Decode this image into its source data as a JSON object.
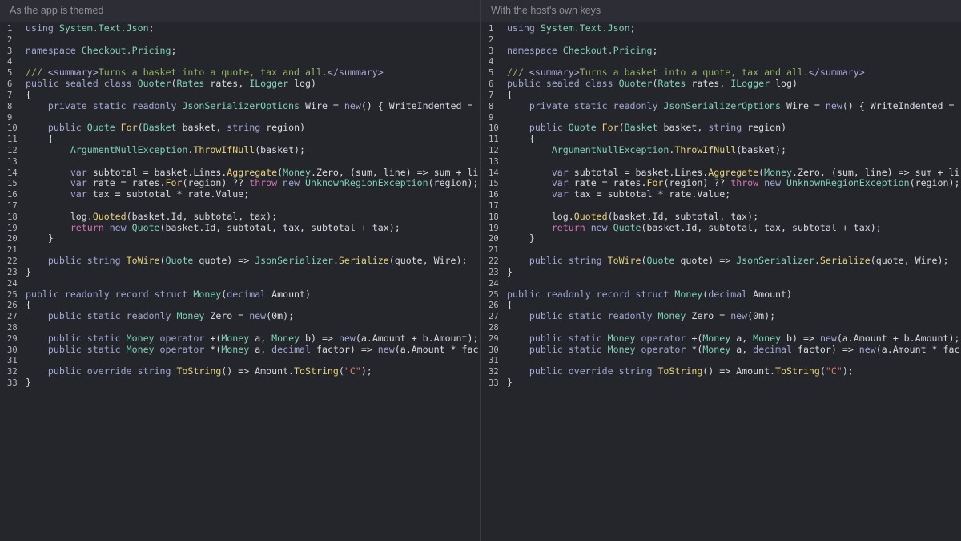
{
  "panes": [
    {
      "title": "As the app is themed"
    },
    {
      "title": "With the host's own keys"
    }
  ],
  "code_lines": [
    {
      "n": "1",
      "tokens": [
        [
          "kw",
          "using "
        ],
        [
          "ty",
          "System.Text.Json"
        ],
        [
          "pl",
          ";"
        ]
      ]
    },
    {
      "n": "2",
      "tokens": []
    },
    {
      "n": "3",
      "tokens": [
        [
          "kw",
          "namespace "
        ],
        [
          "ty",
          "Checkout.Pricing"
        ],
        [
          "pl",
          ";"
        ]
      ]
    },
    {
      "n": "4",
      "tokens": []
    },
    {
      "n": "5",
      "tokens": [
        [
          "cm",
          "/// "
        ],
        [
          "tag",
          "<summary>"
        ],
        [
          "cm",
          "Turns a basket into a quote, tax and all."
        ],
        [
          "tag",
          "</summary>"
        ]
      ]
    },
    {
      "n": "6",
      "tokens": [
        [
          "kw",
          "public sealed class "
        ],
        [
          "ty",
          "Quoter"
        ],
        [
          "pl",
          "("
        ],
        [
          "ty",
          "Rates"
        ],
        [
          "pl",
          " rates, "
        ],
        [
          "ty",
          "ILogger"
        ],
        [
          "pl",
          " log)"
        ]
      ]
    },
    {
      "n": "7",
      "tokens": [
        [
          "pl",
          "{"
        ]
      ]
    },
    {
      "n": "8",
      "tokens": [
        [
          "pl",
          "    "
        ],
        [
          "kw",
          "private static readonly "
        ],
        [
          "ty",
          "JsonSerializerOptions"
        ],
        [
          "pl",
          " Wire = "
        ],
        [
          "kw",
          "new"
        ],
        [
          "pl",
          "() { WriteIndented = "
        ]
      ]
    },
    {
      "n": "9",
      "tokens": []
    },
    {
      "n": "10",
      "tokens": [
        [
          "pl",
          "    "
        ],
        [
          "kw",
          "public "
        ],
        [
          "ty",
          "Quote "
        ],
        [
          "fn",
          "For"
        ],
        [
          "pl",
          "("
        ],
        [
          "ty",
          "Basket"
        ],
        [
          "pl",
          " basket, "
        ],
        [
          "kw",
          "string"
        ],
        [
          "pl",
          " region)"
        ]
      ]
    },
    {
      "n": "11",
      "tokens": [
        [
          "pl",
          "    {"
        ]
      ]
    },
    {
      "n": "12",
      "tokens": [
        [
          "pl",
          "        "
        ],
        [
          "ty",
          "ArgumentNullException"
        ],
        [
          "pl",
          "."
        ],
        [
          "fn",
          "ThrowIfNull"
        ],
        [
          "pl",
          "(basket);"
        ]
      ]
    },
    {
      "n": "13",
      "tokens": []
    },
    {
      "n": "14",
      "tokens": [
        [
          "pl",
          "        "
        ],
        [
          "kw",
          "var"
        ],
        [
          "pl",
          " subtotal = basket.Lines."
        ],
        [
          "fn",
          "Aggregate"
        ],
        [
          "pl",
          "("
        ],
        [
          "ty",
          "Money"
        ],
        [
          "pl",
          ".Zero, (sum, line) => sum + li"
        ]
      ]
    },
    {
      "n": "15",
      "tokens": [
        [
          "pl",
          "        "
        ],
        [
          "kw",
          "var"
        ],
        [
          "pl",
          " rate = rates."
        ],
        [
          "fn",
          "For"
        ],
        [
          "pl",
          "(region) ?? "
        ],
        [
          "ctl",
          "throw "
        ],
        [
          "kw",
          "new "
        ],
        [
          "ty",
          "UnknownRegionException"
        ],
        [
          "pl",
          "(region);"
        ]
      ]
    },
    {
      "n": "16",
      "tokens": [
        [
          "pl",
          "        "
        ],
        [
          "kw",
          "var"
        ],
        [
          "pl",
          " tax = subtotal * rate.Value;"
        ]
      ]
    },
    {
      "n": "17",
      "tokens": []
    },
    {
      "n": "18",
      "tokens": [
        [
          "pl",
          "        log."
        ],
        [
          "fn",
          "Quoted"
        ],
        [
          "pl",
          "(basket.Id, subtotal, tax);"
        ]
      ]
    },
    {
      "n": "19",
      "tokens": [
        [
          "pl",
          "        "
        ],
        [
          "ctl",
          "return "
        ],
        [
          "kw",
          "new "
        ],
        [
          "ty",
          "Quote"
        ],
        [
          "pl",
          "(basket.Id, subtotal, tax, subtotal + tax);"
        ]
      ]
    },
    {
      "n": "20",
      "tokens": [
        [
          "pl",
          "    }"
        ]
      ]
    },
    {
      "n": "21",
      "tokens": []
    },
    {
      "n": "22",
      "tokens": [
        [
          "pl",
          "    "
        ],
        [
          "kw",
          "public string "
        ],
        [
          "fn",
          "ToWire"
        ],
        [
          "pl",
          "("
        ],
        [
          "ty",
          "Quote"
        ],
        [
          "pl",
          " quote) => "
        ],
        [
          "ty",
          "JsonSerializer"
        ],
        [
          "pl",
          "."
        ],
        [
          "fn",
          "Serialize"
        ],
        [
          "pl",
          "(quote, Wire);"
        ]
      ]
    },
    {
      "n": "23",
      "tokens": [
        [
          "pl",
          "}"
        ]
      ]
    },
    {
      "n": "24",
      "tokens": []
    },
    {
      "n": "25",
      "tokens": [
        [
          "kw",
          "public readonly record struct "
        ],
        [
          "ty",
          "Money"
        ],
        [
          "pl",
          "("
        ],
        [
          "kw",
          "decimal"
        ],
        [
          "pl",
          " Amount)"
        ]
      ]
    },
    {
      "n": "26",
      "tokens": [
        [
          "pl",
          "{"
        ]
      ]
    },
    {
      "n": "27",
      "tokens": [
        [
          "pl",
          "    "
        ],
        [
          "kw",
          "public static readonly "
        ],
        [
          "ty",
          "Money"
        ],
        [
          "pl",
          " Zero = "
        ],
        [
          "kw",
          "new"
        ],
        [
          "pl",
          "(0m);"
        ]
      ]
    },
    {
      "n": "28",
      "tokens": []
    },
    {
      "n": "29",
      "tokens": [
        [
          "pl",
          "    "
        ],
        [
          "kw",
          "public static "
        ],
        [
          "ty",
          "Money "
        ],
        [
          "kw",
          "operator "
        ],
        [
          "pl",
          "+("
        ],
        [
          "ty",
          "Money"
        ],
        [
          "pl",
          " a, "
        ],
        [
          "ty",
          "Money"
        ],
        [
          "pl",
          " b) => "
        ],
        [
          "kw",
          "new"
        ],
        [
          "pl",
          "(a.Amount + b.Amount);"
        ]
      ]
    },
    {
      "n": "30",
      "tokens": [
        [
          "pl",
          "    "
        ],
        [
          "kw",
          "public static "
        ],
        [
          "ty",
          "Money "
        ],
        [
          "kw",
          "operator "
        ],
        [
          "pl",
          "*("
        ],
        [
          "ty",
          "Money"
        ],
        [
          "pl",
          " a, "
        ],
        [
          "kw",
          "decimal"
        ],
        [
          "pl",
          " factor) => "
        ],
        [
          "kw",
          "new"
        ],
        [
          "pl",
          "(a.Amount * fac"
        ]
      ]
    },
    {
      "n": "31",
      "tokens": []
    },
    {
      "n": "32",
      "tokens": [
        [
          "pl",
          "    "
        ],
        [
          "kw",
          "public override string "
        ],
        [
          "fn",
          "ToString"
        ],
        [
          "pl",
          "() => Amount."
        ],
        [
          "fn",
          "ToString"
        ],
        [
          "pl",
          "("
        ],
        [
          "str",
          "\"C\""
        ],
        [
          "pl",
          ");"
        ]
      ]
    },
    {
      "n": "33",
      "tokens": [
        [
          "pl",
          "}"
        ]
      ]
    }
  ]
}
